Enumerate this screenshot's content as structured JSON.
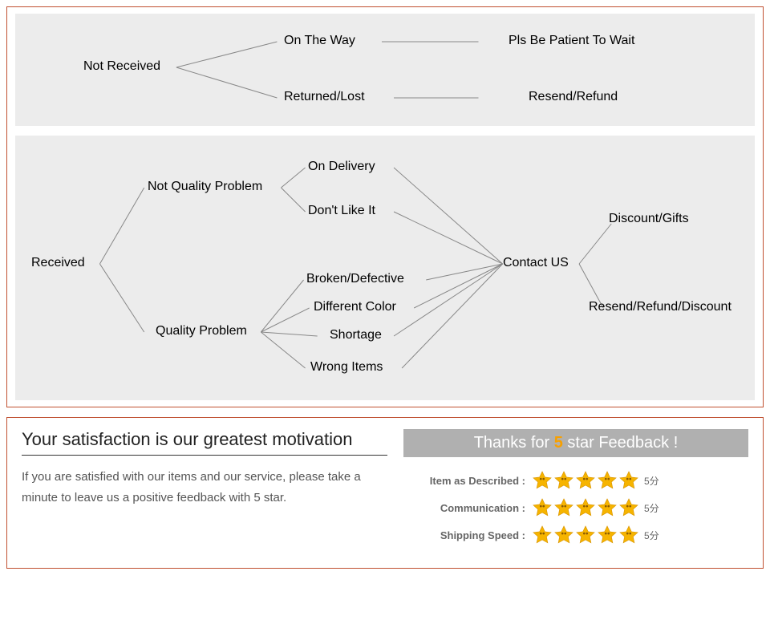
{
  "diagram1": {
    "root": "Not Received",
    "b1": "On The Way",
    "b2": "Returned/Lost",
    "r1": "Pls Be Patient To Wait",
    "r2": "Resend/Refund"
  },
  "diagram2": {
    "root": "Received",
    "nqp": "Not Quality Problem",
    "qp": "Quality Problem",
    "nqp_a": "On Delivery",
    "nqp_b": "Don't Like It",
    "qp_a": "Broken/Defective",
    "qp_b": "Different Color",
    "qp_c": "Shortage",
    "qp_d": "Wrong Items",
    "contact": "Contact US",
    "out1": "Discount/Gifts",
    "out2": "Resend/Refund/Discount"
  },
  "feedback": {
    "title": "Your satisfaction is our greatest motivation",
    "body": "If you are satisfied with our items and our service, please take a minute to leave us a positive feedback with 5 star.",
    "thanks_pre": "Thanks for ",
    "thanks_num": "5",
    "thanks_post": " star Feedback !",
    "rows": [
      {
        "label": "Item as Described :",
        "score": "5分"
      },
      {
        "label": "Communication :",
        "score": "5分"
      },
      {
        "label": "Shipping Speed :",
        "score": "5分"
      }
    ]
  }
}
